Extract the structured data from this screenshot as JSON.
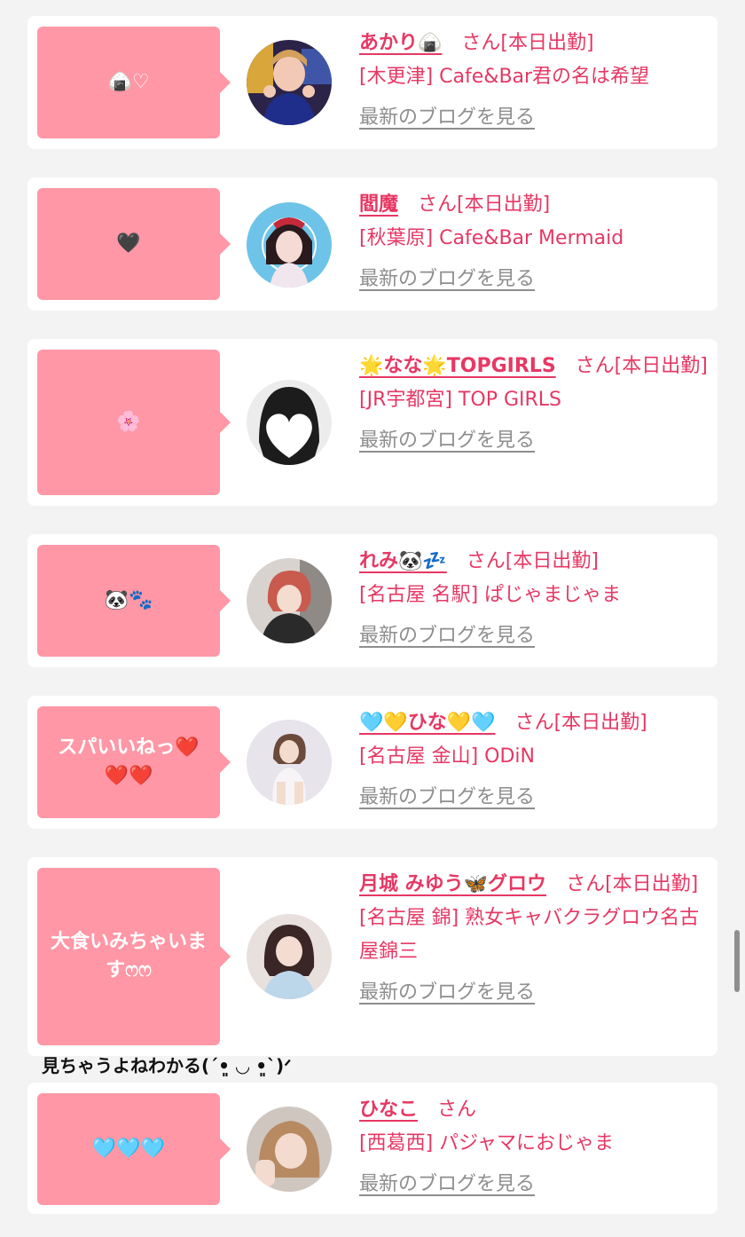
{
  "entries": [
    {
      "bubble": "🍙♡",
      "name": "あかり🍙",
      "suffix": "さん[本日出勤]",
      "shop": "[木更津] Cafe&Bar君の名は希望",
      "blog": "最新のブログを見る"
    },
    {
      "bubble": "🖤",
      "name": "閻魔",
      "suffix": "さん[本日出勤]",
      "shop": "[秋葉原] Cafe&Bar Mermaid",
      "blog": "最新のブログを見る"
    },
    {
      "bubble": "🌸",
      "name": "🌟なな🌟TOPGIRLS",
      "suffix": "さん[本日出勤]",
      "shop": "[JR宇都宮] TOP GIRLS",
      "blog": "最新のブログを見る"
    },
    {
      "bubble": "🐼🐾",
      "name": "れみ🐼💤",
      "suffix": "さん[本日出勤]",
      "shop": "[名古屋 名駅] ぱじゃまじゃま",
      "blog": "最新のブログを見る"
    },
    {
      "bubble": "スパいいねっ❤️❤️❤️",
      "name": "🩵💛ひな💛🩵",
      "suffix": "さん[本日出勤]",
      "shop": "[名古屋 金山] ODiN",
      "blog": "最新のブログを見る"
    },
    {
      "bubble": "大食いみちゃいますෆෆ",
      "name": "月城 みゆう🦋グロウ",
      "suffix": "さん[本日出勤]",
      "shop": "[名古屋 錦] 熟女キャバクラグロウ名古屋錦三",
      "blog": "最新のブログを見る"
    },
    {
      "bubble": "🩵🩵🩵",
      "name": "ひなこ",
      "suffix": "さん",
      "shop": "[西葛西] パジャマにおじゃま",
      "blog": "最新のブログを見る"
    }
  ],
  "comment": "見ちゃうよねわかる(ˊ•͈ ◡ •͈ˋ)ᐟ",
  "colors": {
    "bubble": "#ff97a6",
    "name": "#e63864",
    "blog_link": "#8e8e8e"
  }
}
